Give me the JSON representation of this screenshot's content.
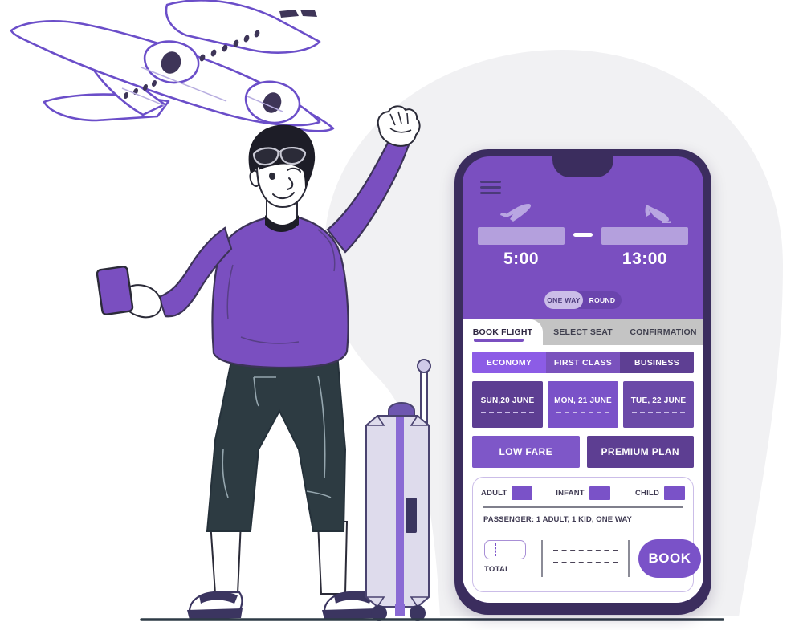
{
  "scene": {
    "title": "Flight booking illustration",
    "colors": {
      "phone_frame": "#3b2d5e",
      "phone_screen": "#7a4fc0",
      "accent_purple": "#7a52c8",
      "light_purple": "#b4a0dd",
      "deep_purple": "#5d3e92",
      "bright_purple": "#8c5ce6",
      "background_blob": "#f1f1f3",
      "shirt": "#7a4fc0",
      "shorts": "#2d3b42",
      "hair": "#1d1d27",
      "ground_line": "#2e3b46"
    },
    "illustration": {
      "airplane": "airplane-takeoff-illustration",
      "person": "traveler-man-illustration",
      "suitcase": "rolling-suitcase-illustration",
      "backdrop": "arch-blob-backdrop"
    }
  },
  "phone": {
    "menu_icon": "hamburger-menu-icon",
    "departure": {
      "icon": "plane-takeoff-icon",
      "field_value": "",
      "time": "5:00"
    },
    "arrival": {
      "icon": "plane-landing-icon",
      "field_value": "",
      "time": "13:00"
    },
    "separator": "—",
    "trip_toggle": {
      "options": [
        "ONE WAY",
        "ROUND"
      ],
      "selected": "ONE WAY"
    },
    "tabs": [
      {
        "label": "BOOK FLIGHT",
        "active": true
      },
      {
        "label": "SELECT SEAT",
        "active": false
      },
      {
        "label": "CONFIRMATION",
        "active": false
      }
    ],
    "cabin_classes": [
      {
        "label": "ECONOMY",
        "selected": true
      },
      {
        "label": "FIRST CLASS",
        "selected": false
      },
      {
        "label": "BUSINESS",
        "selected": false
      }
    ],
    "dates": [
      {
        "label": "SUN,20 JUNE"
      },
      {
        "label": "MON, 21 JUNE"
      },
      {
        "label": "TUE, 22 JUNE"
      }
    ],
    "fare_options": [
      {
        "label": "LOW FARE"
      },
      {
        "label": "PREMIUM PLAN"
      }
    ],
    "passenger_types": [
      {
        "label": "ADULT",
        "value": ""
      },
      {
        "label": "INFANT",
        "value": ""
      },
      {
        "label": "CHILD",
        "value": ""
      }
    ],
    "passenger_summary": "PASSENGER:  1 ADULT, 1 KID, ONE WAY",
    "total_label": "TOTAL",
    "total_value": "",
    "book_button": "BOOK"
  }
}
